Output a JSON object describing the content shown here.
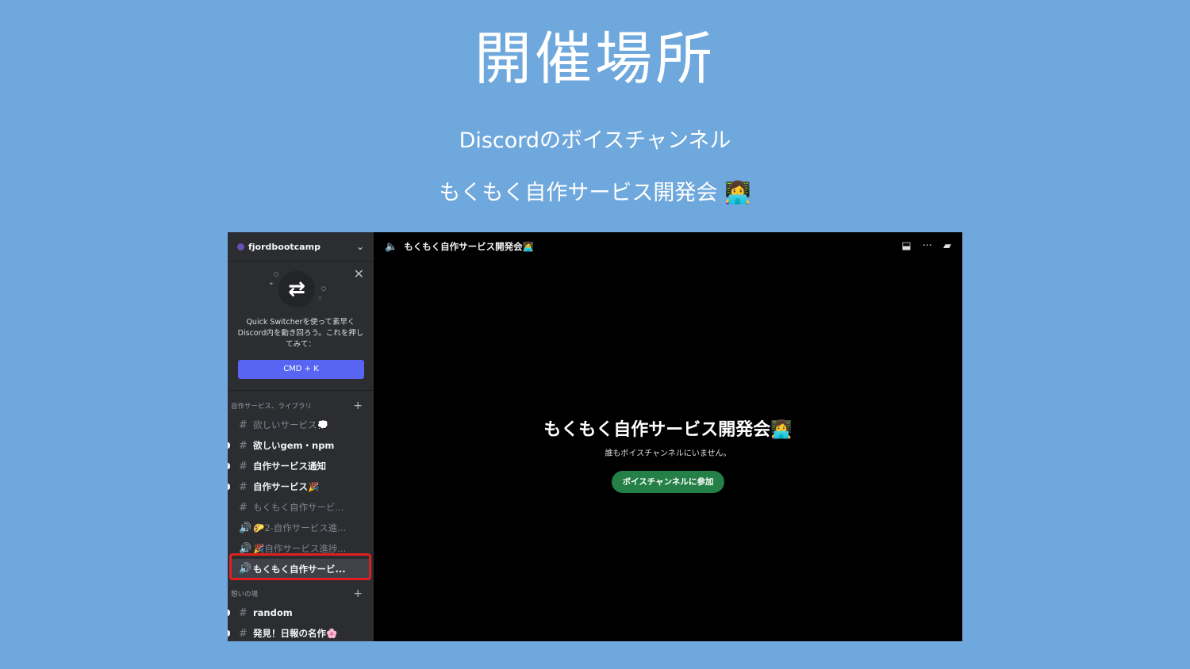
{
  "slide": {
    "title": "開催場所",
    "subtitle1": "Discordのボイスチャンネル",
    "subtitle2": "もくもく自作サービス開発会",
    "subtitle2_emoji": "👩‍💻"
  },
  "discord": {
    "server_name": "fjordbootcamp",
    "promo": {
      "text": "Quick Switcherを使って素早くDiscord内を動き回ろう。これを押してみて：",
      "button": "CMD + K"
    },
    "categories": [
      {
        "label": "自作サービス、ライブラリ",
        "channels": [
          {
            "glyph": "#",
            "name": "欲しいサービス💭",
            "unread": false
          },
          {
            "glyph": "#",
            "name": "欲しいgem・npm",
            "unread": true
          },
          {
            "glyph": "#",
            "name": "自作サービス通知",
            "unread": true
          },
          {
            "glyph": "#",
            "name": "自作サービス🎉",
            "unread": true
          },
          {
            "glyph": "#",
            "name": "もくもく自作サービ...",
            "unread": false
          },
          {
            "glyph": "🔊",
            "name": "🌮2-自作サービス進...",
            "unread": false
          },
          {
            "glyph": "🔊",
            "name": "🎉自作サービス進捗...",
            "unread": false
          },
          {
            "glyph": "🔊",
            "name": "もくもく自作サービ...",
            "selected": true
          }
        ]
      },
      {
        "label": "憩いの場",
        "channels": [
          {
            "glyph": "#",
            "name": "random",
            "unread": true
          },
          {
            "glyph": "#",
            "name": "発見！日報の名作🌸",
            "unread": true
          }
        ]
      }
    ],
    "header": {
      "channel": "もくもく自作サービス開発会👩‍💻"
    },
    "voice": {
      "title": "もくもく自作サービス開発会👩‍💻",
      "empty_text": "誰もボイスチャンネルにいません。",
      "join_button": "ボイスチャンネルに参加"
    },
    "colors": {
      "accent": "#5865f2",
      "join": "#248046",
      "highlight": "#e02020",
      "slide_bg": "#6fa8dc"
    }
  }
}
